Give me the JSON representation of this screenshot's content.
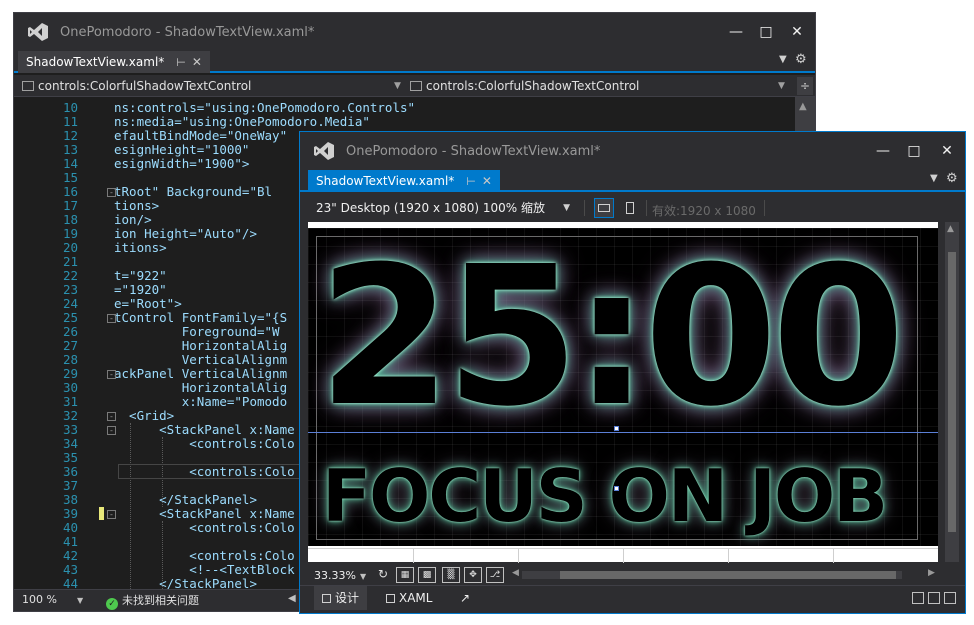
{
  "back_window": {
    "title": "OnePomodoro - ShadowTextView.xaml*",
    "tab_label": "ShadowTextView.xaml*",
    "nav_left": "controls:ColorfulShadowTextControl",
    "nav_right": "controls:ColorfulShadowTextControl",
    "zoom": "100 %",
    "issues": "未找到相关问题",
    "code_lines": [
      {
        "num": "10",
        "text": "ns:controls=\"using:OnePomodoro.Controls\""
      },
      {
        "num": "11",
        "text": "ns:media=\"using:OnePomodoro.Media\""
      },
      {
        "num": "12",
        "text": "efaultBindMode=\"OneWay\""
      },
      {
        "num": "13",
        "text": "esignHeight=\"1000\""
      },
      {
        "num": "14",
        "text": "esignWidth=\"1900\">"
      },
      {
        "num": "15",
        "text": ""
      },
      {
        "num": "16",
        "text": "tRoot\" Background=\"Bl"
      },
      {
        "num": "17",
        "text": "tions>"
      },
      {
        "num": "18",
        "text": "ion/>"
      },
      {
        "num": "19",
        "text": "ion Height=\"Auto\"/>"
      },
      {
        "num": "20",
        "text": "itions>"
      },
      {
        "num": "21",
        "text": ""
      },
      {
        "num": "22",
        "text": "t=\"922\""
      },
      {
        "num": "23",
        "text": "=\"1920\""
      },
      {
        "num": "24",
        "text": "e=\"Root\">"
      },
      {
        "num": "25",
        "text": "tControl FontFamily=\"{S"
      },
      {
        "num": "26",
        "text": "         Foreground=\"W"
      },
      {
        "num": "27",
        "text": "         HorizontalAlig"
      },
      {
        "num": "28",
        "text": "         VerticalAlignm"
      },
      {
        "num": "29",
        "text": "ackPanel VerticalAlignm"
      },
      {
        "num": "30",
        "text": "         HorizontalAlig"
      },
      {
        "num": "31",
        "text": "         x:Name=\"Pomodo"
      },
      {
        "num": "32",
        "text": "  <Grid>"
      },
      {
        "num": "33",
        "text": "      <StackPanel x:Name"
      },
      {
        "num": "34",
        "text": "          <controls:Colo"
      },
      {
        "num": "35",
        "text": ""
      },
      {
        "num": "36",
        "text": "          <controls:Colo"
      },
      {
        "num": "37",
        "text": ""
      },
      {
        "num": "38",
        "text": "      </StackPanel>"
      },
      {
        "num": "39",
        "text": "      <StackPanel x:Name"
      },
      {
        "num": "40",
        "text": "          <controls:Colo"
      },
      {
        "num": "41",
        "text": ""
      },
      {
        "num": "42",
        "text": "          <controls:Colo"
      },
      {
        "num": "43",
        "text": "          <!--<TextBlock"
      },
      {
        "num": "44",
        "text": "      </StackPanel>"
      }
    ]
  },
  "front_window": {
    "title": "OnePomodoro - ShadowTextView.xaml*",
    "tab_label": "ShadowTextView.xaml*",
    "device": "23\" Desktop (1920 x 1080) 100% 缩放",
    "effective": "有效:1920 x 1080",
    "preview_timer": "25:00",
    "preview_caption": "FOCUS ON JOB",
    "zoom": "33.33%",
    "view_design": "设计",
    "view_xaml": "XAML"
  },
  "colors": {
    "accent": "#007acc",
    "glow_green": "#5fd1a8",
    "glow_pink": "#c896c8"
  }
}
